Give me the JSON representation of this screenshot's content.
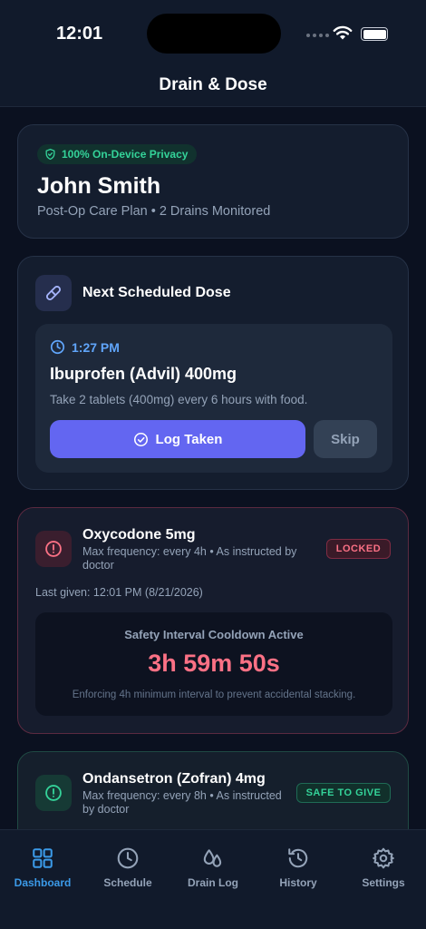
{
  "status": {
    "time": "12:01"
  },
  "header": {
    "title": "Drain & Dose"
  },
  "profile": {
    "privacy_badge": "100% On-Device Privacy",
    "name": "John Smith",
    "subtitle": "Post-Op Care Plan • 2 Drains Monitored"
  },
  "next_dose": {
    "heading": "Next Scheduled Dose",
    "time": "1:27 PM",
    "medication": "Ibuprofen (Advil) 400mg",
    "instructions": "Take 2 tablets (400mg) every 6 hours with food.",
    "log_button": "Log Taken",
    "skip_button": "Skip"
  },
  "oxycodone": {
    "name": "Oxycodone 5mg",
    "frequency": "Max frequency: every 4h • As instructed by doctor",
    "status": "LOCKED",
    "last_given": "Last given: 12:01 PM (8/21/2026)",
    "cooldown_title": "Safety Interval Cooldown Active",
    "cooldown_timer": "3h 59m 50s",
    "cooldown_note": "Enforcing 4h minimum interval to prevent accidental stacking."
  },
  "ondansetron": {
    "name": "Ondansetron (Zofran) 4mg",
    "frequency": "Max frequency: every 8h • As instructed by doctor",
    "status": "SAFE TO GIVE"
  },
  "tabs": [
    {
      "label": "Dashboard",
      "icon": "grid-icon",
      "active": true
    },
    {
      "label": "Schedule",
      "icon": "clock-icon"
    },
    {
      "label": "Drain Log",
      "icon": "droplets-icon"
    },
    {
      "label": "History",
      "icon": "history-icon"
    },
    {
      "label": "Settings",
      "icon": "gear-icon"
    }
  ],
  "colors": {
    "accent": "#6366f1",
    "active_tab": "#3b9ae8",
    "locked": "#fb7185",
    "safe": "#34d399"
  }
}
